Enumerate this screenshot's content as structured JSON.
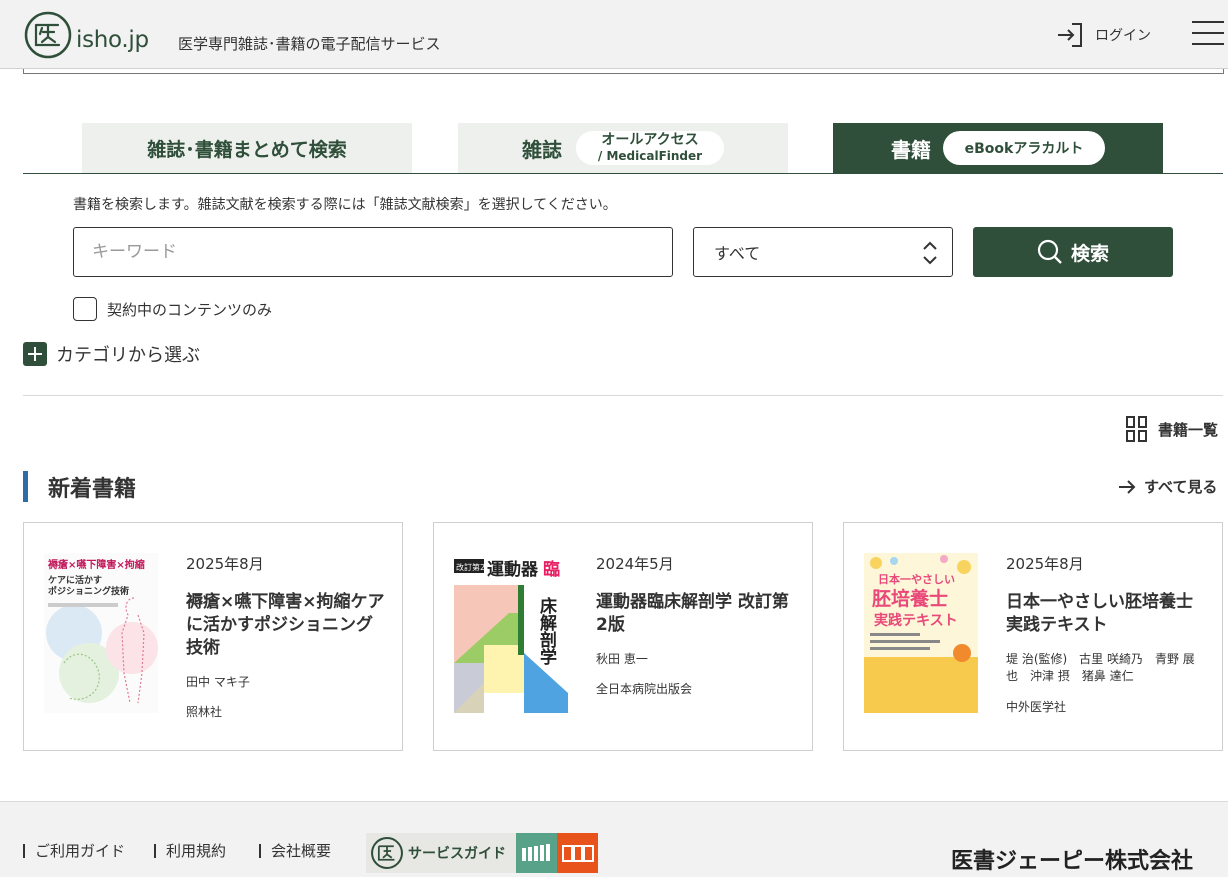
{
  "header": {
    "logo_text": "isho.jp",
    "tagline": "医学専門雑誌･書籍の電子配信サービス",
    "login_label": "ログイン"
  },
  "tabs": {
    "all_label": "雑誌･書籍まとめて検索",
    "magazine_label": "雑誌",
    "magazine_pill_line1": "オールアクセス",
    "magazine_pill_line2": "/ MedicalFinder",
    "book_label": "書籍",
    "book_pill": "eBookアラカルト",
    "active": "book"
  },
  "search": {
    "note": "書籍を検索します。雑誌文献を検索する際には「雑誌文献検索」を選択してください。",
    "placeholder": "キーワード",
    "scope_value": "すべて",
    "button_label": "検索",
    "contract_only_label": "契約中のコンテンツのみ",
    "contract_only_checked": false,
    "category_label": "カテゴリから選ぶ"
  },
  "book_list_label": "書籍一覧",
  "new_books": {
    "title": "新着書籍",
    "see_all_label": "すべて見る",
    "items": [
      {
        "date": "2025年8月",
        "title": "褥瘡×嚥下障害×拘縮ケアに活かすポジショニング技術",
        "author": "田中 マキ子",
        "publisher": "照林社",
        "cover_title_line1": "褥瘡×嚥下障害×拘縮",
        "cover_title_line2": "ケアに活かす",
        "cover_title_line3": "ポジショニング技術"
      },
      {
        "date": "2024年5月",
        "title": "運動器臨床解剖学 改訂第2版",
        "author": "秋田 恵一",
        "publisher": "全日本病院出版会",
        "cover_badge": "改訂第2版",
        "cover_title_h": "運動器",
        "cover_title_accent": "臨",
        "cover_title_v": "床解剖学"
      },
      {
        "date": "2025年8月",
        "title": "日本一やさしい胚培養士実践テキスト",
        "author": "堤 治(監修)　古里 咲綺乃　青野 展也　沖津 摂　猪鼻 達仁",
        "publisher": "中外医学社",
        "cover_title_line1": "日本一やさしい",
        "cover_title_line2": "胚培養士",
        "cover_title_line3": "実践テキスト"
      }
    ]
  },
  "footer": {
    "links": [
      "ご利用ガイド",
      "利用規約",
      "会社概要"
    ],
    "service_guide_label": "サービスガイド",
    "company_name": "医書ジェーピー株式会社"
  },
  "colors": {
    "brand_green": "#2f4f3a",
    "accent_blue": "#2e6da4",
    "footer_bg": "#f1f2f1"
  }
}
